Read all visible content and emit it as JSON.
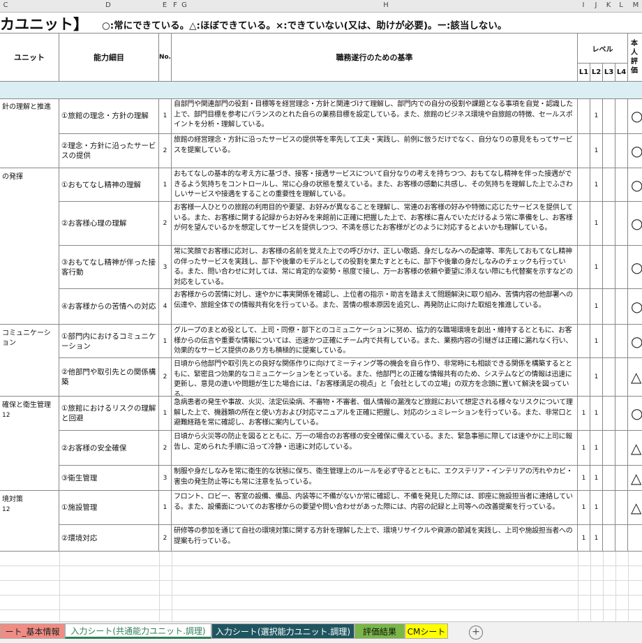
{
  "column_headers": [
    "C",
    "D",
    "E",
    "F",
    "G",
    "H",
    "I",
    "J",
    "K",
    "L",
    "M"
  ],
  "title": "カユニット】",
  "legend": "○:常にできている。△:ほぼできている。×:できていない(又は、助けが必要)。ー:該当しない。",
  "headers": {
    "unit": "ユニット",
    "detail": "能力細目",
    "no": "No.",
    "standard": "職務遂行のための基準",
    "level": "レベル",
    "l1": "L1",
    "l2": "L2",
    "l3": "L3",
    "l4": "L4",
    "self_eval": "本人評価"
  },
  "units": [
    {
      "label": "針の理解と推進",
      "sub": ""
    },
    {
      "label": "の発揮",
      "sub": ""
    },
    {
      "label": "コミュニケーション",
      "sub": ""
    },
    {
      "label": "確保と衛生管理",
      "sub": "12"
    },
    {
      "label": "境対策",
      "sub": "12"
    }
  ],
  "rows": [
    {
      "detail": "①旅館の理念・方針の理解",
      "no": "1",
      "standard": "自部門や関連部門の役割・目標等を経営理念・方針と関連づけて理解し、部門内での自分の役割や課題となる事項を自覚・認識した上で、部門目標を参考にバランスのとれた自らの業務目標を設定している。また、旅館のビジネス環境や自旅館の特徴、セールスポイントを分析・理解している。",
      "l1": "",
      "l2": "1",
      "eval": "○"
    },
    {
      "detail": "②理念・方針に沿ったサービスの提供",
      "no": "2",
      "standard": "旅館の経営理念・方針に沿ったサービスの提供等を率先して工夫・実践し、前例に倣うだけでなく、自分なりの意見をもってサービスを提案している。",
      "l1": "",
      "l2": "1",
      "eval": "○"
    },
    {
      "detail": "①おもてなし精神の理解",
      "no": "1",
      "standard": "おもてなしの基本的な考え方に基づき、接客・接遇サービスについて自分なりの考えを持ちつつ、おもてなし精神を伴った接遇ができるよう気持ちをコントロールし、常に心身の状態を整えている。また、お客様の感動に共感し、その気持ちを理解した上でふさわしいサービスや接遇をすることの重要性を理解している。",
      "l1": "",
      "l2": "1",
      "eval": "○"
    },
    {
      "detail": "②お客様心理の理解",
      "no": "2",
      "standard": "お客様一人ひとりの旅館の利用目的や要望、お好みが異なることを理解し、常連のお客様の好みや特徴に応じたサービスを提供している。また、お客様に関する記録からお好みを来館前に正確に把握した上で、お客様に喜んでいただけるよう常に準備をし、お客様が何を望んでいるかを想定してサービスを提供しつつ、不満を感じたお客様がどのように対応するとよいかも理解している。",
      "l1": "",
      "l2": "1",
      "eval": "○"
    },
    {
      "detail": "③おもてなし精神が伴った接客行動",
      "no": "3",
      "standard": "常に笑顔でお客様に応対し、お客様の名前を覚えた上での呼びかけ、正しい敬語、身だしなみへの配慮等、率先しておもてなし精神の伴ったサービスを実践し、部下や後輩のモデルとしての役割を果たすとともに、部下や後輩の身だしなみのチェックも行っている。また、問い合わせに対しては、常に肯定的な姿勢・態度で接し、万一お客様の依頼や要望に添えない際にも代替案を示すなどの対応をしている。",
      "l1": "",
      "l2": "1",
      "eval": "○"
    },
    {
      "detail": "④お客様からの苦情への対応",
      "no": "4",
      "standard": "お客様からの苦情に対し、速やかに事実関係を確認し、上位者の指示・助言を踏まえて問題解決に取り組み、苦情内容の他部署への伝達や、旅館全体での情報共有化を行っている。また、苦情の根本原因を追究し、再発防止に向けた取組を推進している。",
      "l1": "",
      "l2": "1",
      "eval": "○"
    },
    {
      "detail": "①部門内におけるコミュニケーション",
      "no": "1",
      "standard": "グループのまとめ役として、上司・同僚・部下とのコミュニケーションに努め、協力的な職場環境を創出・維持するとともに、お客様からの伝言や重要な情報については、迅速かつ正確にチーム内で共有している。また、業務内容の引継ぎは正確に漏れなく行い、効果的なサービス提供のあり方も積極的に提案している。",
      "l1": "",
      "l2": "1",
      "eval": "○"
    },
    {
      "detail": "②他部門や取引先との関係構築",
      "no": "2",
      "standard": "日頃から他部門や取引先との良好な関係作りに向けてミーティング等の機会を自ら作り、非常時にも相談できる関係を構築するとともに、緊密且つ効果的なコミュニケーションをとっている。また、他部門との正確な情報共有のため、システムなどの情報は迅速に更新し、意見の違いや問題が生じた場合には、「お客様満足の視点」と「会社としての立場」の双方を念頭に置いて解決を図っている。",
      "l1": "",
      "l2": "1",
      "eval": "△"
    },
    {
      "detail": "①旅館におけるリスクの理解と回避",
      "no": "1",
      "standard": "急病患者の発生や事故、火災、法定伝染病、不審物・不審者、個人情報の漏洩など旅館において想定される様々なリスクについて理解した上で、機器類の所在と使い方および対応マニュアルを正確に把握し、対応のシュミレーションを行っている。また、非常口と避難経路を常に確認し、お客様に案内している。",
      "l1": "1",
      "l2": "1",
      "eval": "○"
    },
    {
      "detail": "②お客様の安全確保",
      "no": "2",
      "standard": "日頃から火災等の防止を図るとともに、万一の場合のお客様の安全確保に備えている。また、緊急事態に際しては速やかに上司に報告し、定められた手順に沿って冷静・迅速に対応している。",
      "l1": "1",
      "l2": "1",
      "eval": "△"
    },
    {
      "detail": "③衛生管理",
      "no": "3",
      "standard": "制服や身だしなみを常に衛生的な状態に保ち、衛生管理上のルールを必ず守るとともに、エクステリア・インテリアの汚れやカビ・害虫の発生防止等にも常に注意を払っている。",
      "l1": "1",
      "l2": "1",
      "eval": "△"
    },
    {
      "detail": "①施設管理",
      "no": "1",
      "standard": "フロント、ロビー、客室の設備、備品、内装等に不備がないか常に確認し、不備を発見した際には、即座に施設担当者に連絡している。また、設備面についてのお客様からの要望や問い合わせがあった際には、内容の記録と上司等への改善提案を行っている。",
      "l1": "1",
      "l2": "1",
      "eval": "△"
    },
    {
      "detail": "②環境対応",
      "no": "2",
      "standard": "研修等の参加を通じて自社の環境対策に関する方針を理解した上で、環境リサイクルや資源の節減を実践し、上司や施設担当者への提案も行っている。",
      "l1": "1",
      "l2": "1",
      "eval": ""
    }
  ],
  "tabs": [
    {
      "label": "ート_基本情報",
      "bg": "#ef8d84",
      "fg": "#222222"
    },
    {
      "label": "入力シート(共通能力ユニット.調理)",
      "bg": "#ffffff",
      "fg": "#2e7d57"
    },
    {
      "label": "入力シート(選択能力ユニット.調理)",
      "bg": "#1f5560",
      "fg": "#ffffff"
    },
    {
      "label": "評価結果",
      "bg": "#7ab648",
      "fg": "#111111"
    },
    {
      "label": "CMシート",
      "bg": "#ffff00",
      "fg": "#111111"
    }
  ],
  "add_sheet_symbol": "+"
}
